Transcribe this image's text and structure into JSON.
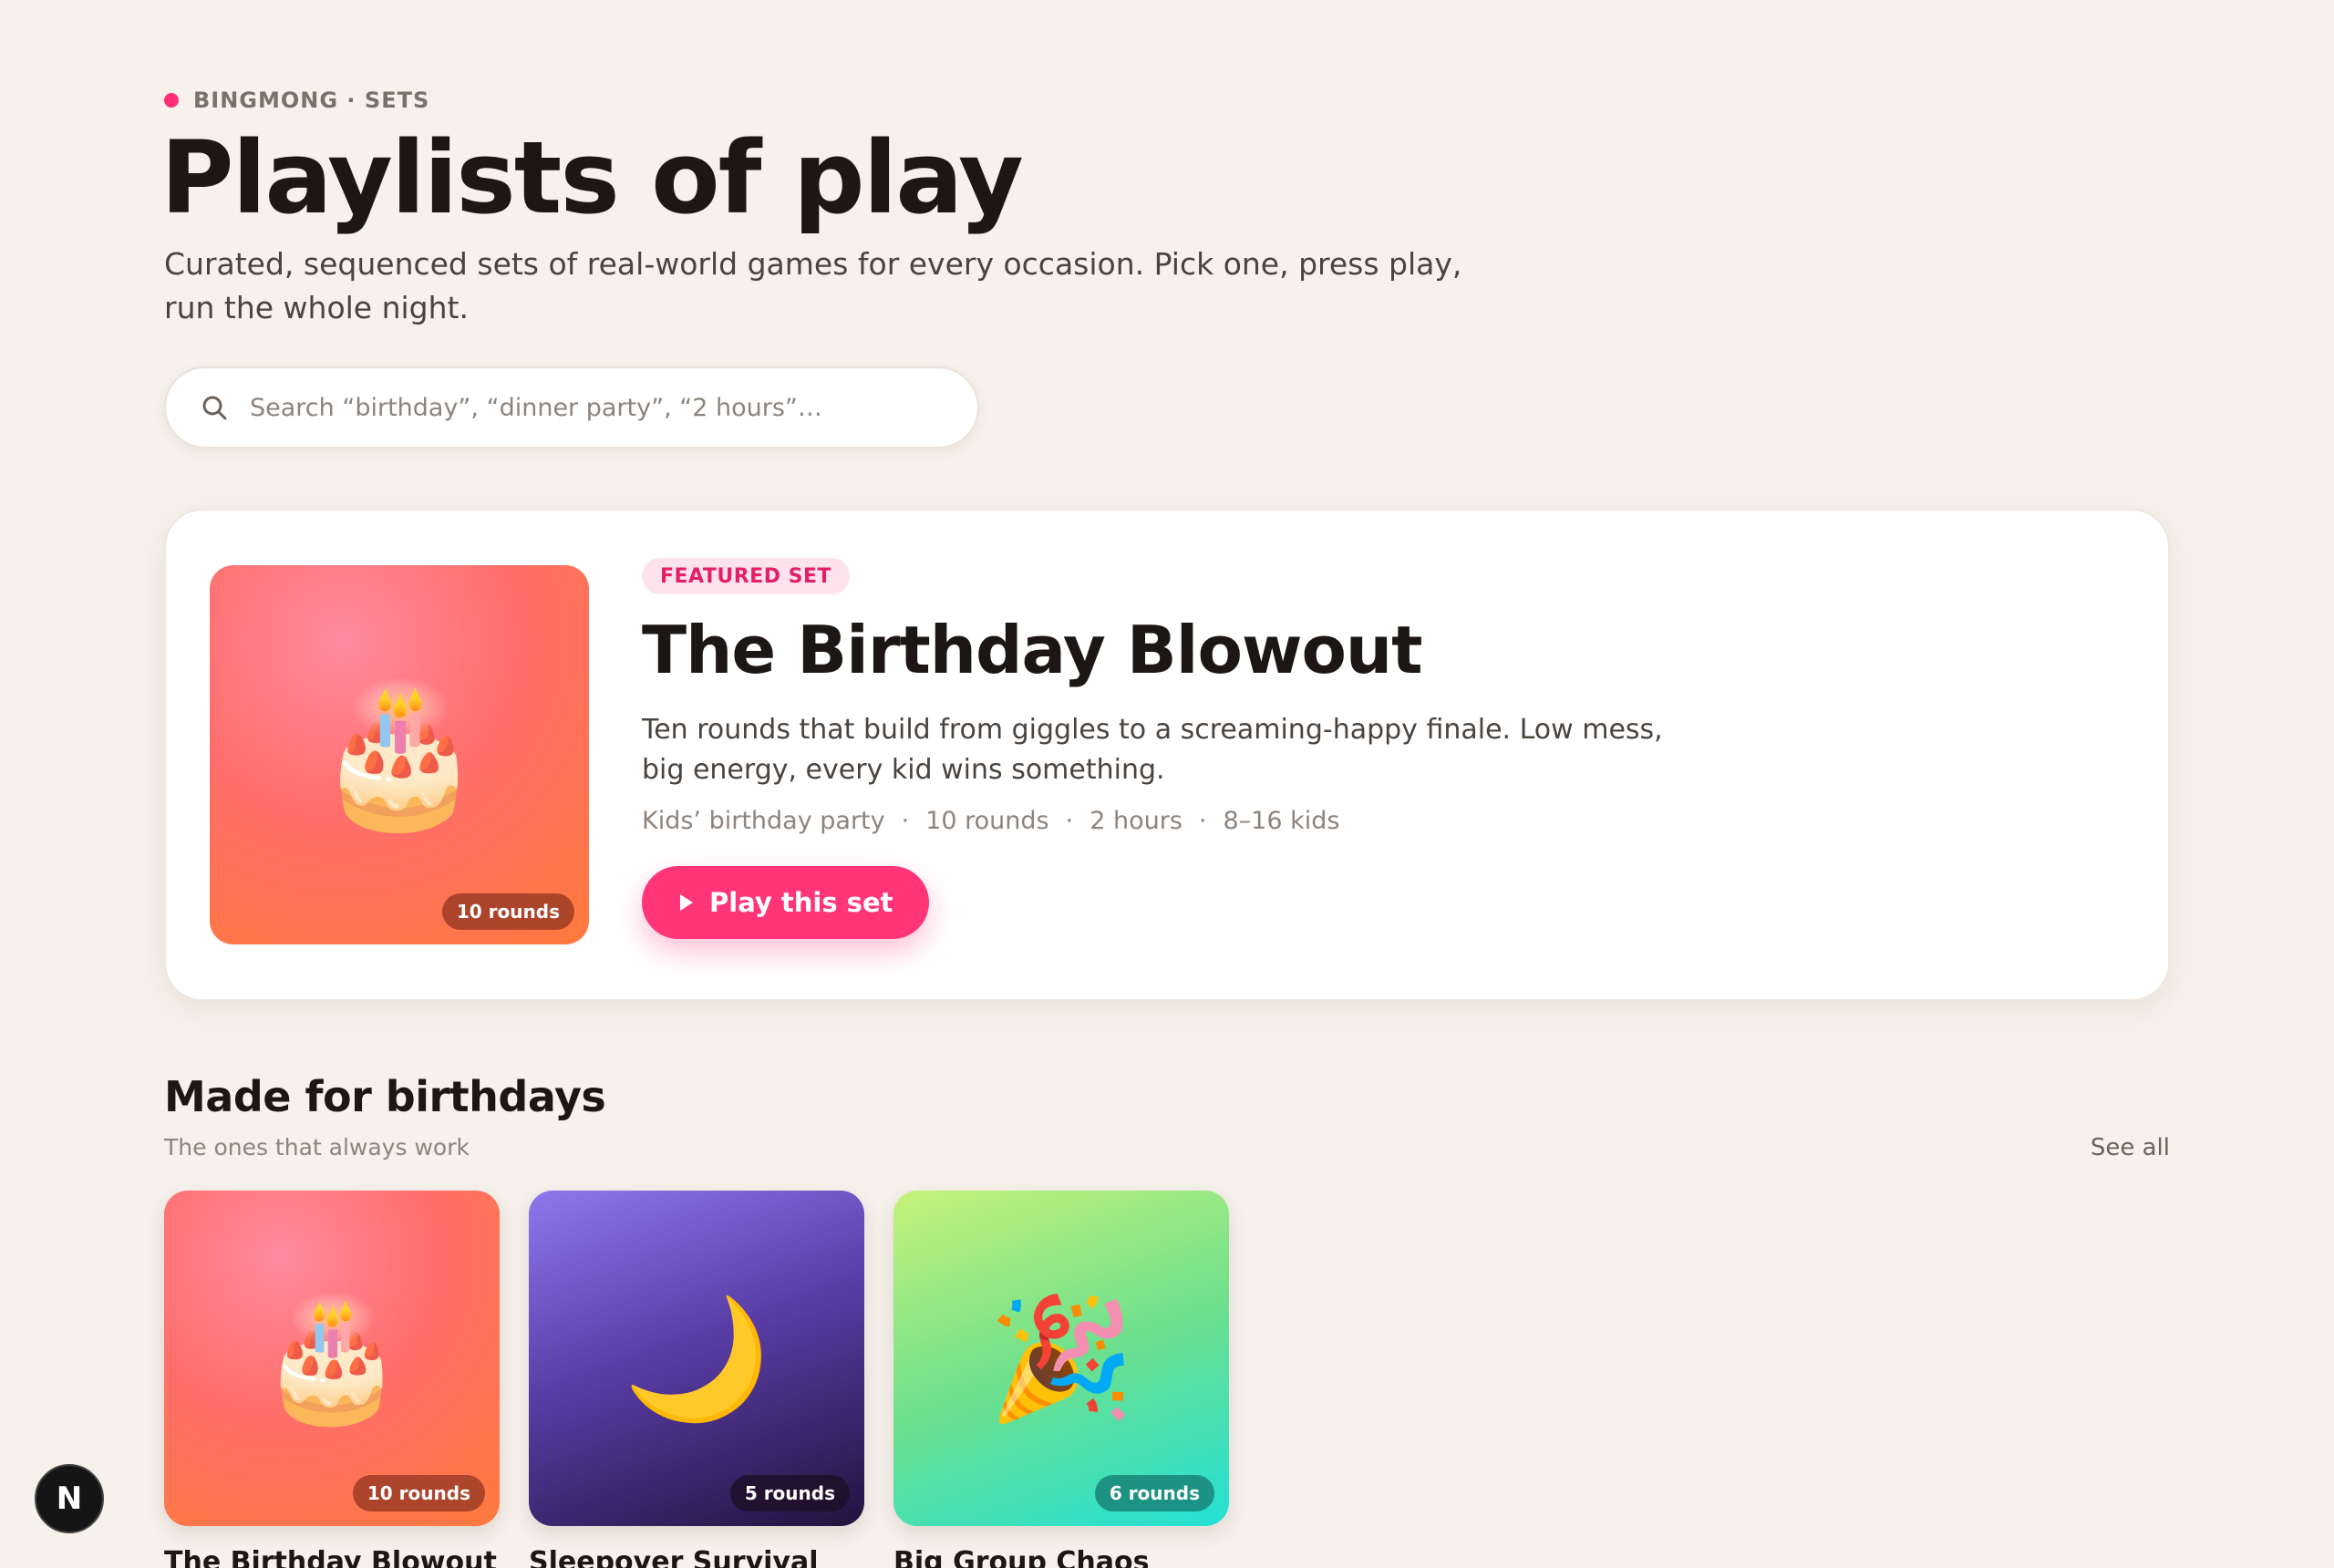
{
  "header": {
    "eyebrow": "BINGMONG · SETS",
    "title": "Playlists of play",
    "subtitle": "Curated, sequenced sets of real-world games for every occasion. Pick one, press play, run the whole night."
  },
  "search": {
    "placeholder": "Search “birthday”, “dinner party”, “2 hours”…",
    "value": ""
  },
  "featured": {
    "tag": "FEATURED SET",
    "title": "The Birthday Blowout",
    "description": "Ten rounds that build from giggles to a screaming-happy finale. Low mess, big energy, every kid wins something.",
    "meta": [
      "Kids’ birthday party",
      "10 rounds",
      "2 hours",
      "8–16 kids"
    ],
    "meta_separator": "·",
    "emoji": "🎂",
    "badge": "10 rounds",
    "cta": "Play this set"
  },
  "section": {
    "title": "Made for birthdays",
    "subtitle": "The ones that always work",
    "see_all": "See all",
    "cards": [
      {
        "name": "The Birthday Blowout",
        "emoji": "🎂",
        "badge": "10 rounds"
      },
      {
        "name": "Sleepover Survival",
        "emoji": "🌙",
        "badge": "5 rounds"
      },
      {
        "name": "Big Group Chaos",
        "emoji": "🎉",
        "badge": "6 rounds"
      }
    ]
  },
  "dev_badge": {
    "label": "N"
  },
  "colors": {
    "background": "#f6f1eb",
    "accent": "#ff3578",
    "tag_bg": "#ffe3ec",
    "tag_text": "#e41f68"
  }
}
